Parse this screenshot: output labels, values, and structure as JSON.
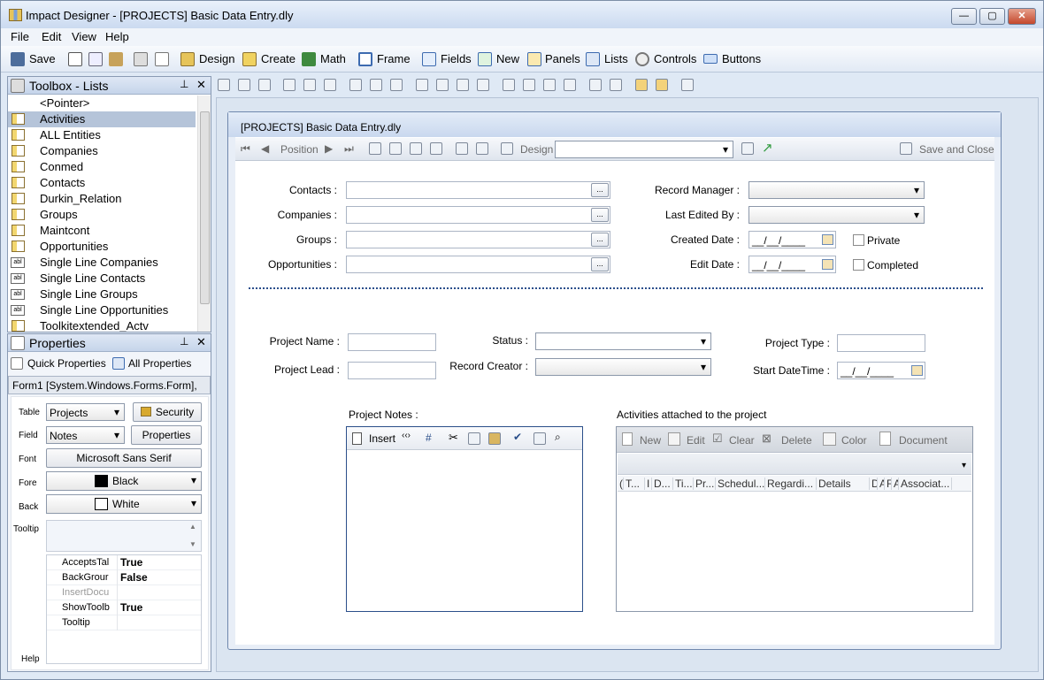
{
  "window": {
    "title": "Impact Designer - [PROJECTS] Basic Data Entry.dly"
  },
  "menu": [
    "File",
    "Edit",
    "View",
    "Help"
  ],
  "toolbar": {
    "save": "Save",
    "design": "Design",
    "create": "Create",
    "math": "Math",
    "frame": "Frame",
    "fields": "Fields",
    "new": "New",
    "panels": "Panels",
    "lists": "Lists",
    "controls": "Controls",
    "buttons": "Buttons"
  },
  "toolbox": {
    "title": "Toolbox - Lists",
    "items": [
      {
        "label": "<Pointer>",
        "icon": "none"
      },
      {
        "label": "Activities",
        "icon": "table"
      },
      {
        "label": "ALL Entities",
        "icon": "table"
      },
      {
        "label": "Companies",
        "icon": "table"
      },
      {
        "label": "Conmed",
        "icon": "table"
      },
      {
        "label": "Contacts",
        "icon": "table"
      },
      {
        "label": "Durkin_Relation",
        "icon": "table"
      },
      {
        "label": "Groups",
        "icon": "table"
      },
      {
        "label": "Maintcont",
        "icon": "table"
      },
      {
        "label": "Opportunities",
        "icon": "table"
      },
      {
        "label": "Single Line Companies",
        "icon": "abl"
      },
      {
        "label": "Single Line Contacts",
        "icon": "abl"
      },
      {
        "label": "Single Line Groups",
        "icon": "abl"
      },
      {
        "label": "Single Line Opportunities",
        "icon": "abl"
      },
      {
        "label": "Toolkitextended_Actv",
        "icon": "table"
      }
    ],
    "abl_text": "abl"
  },
  "properties": {
    "title": "Properties",
    "quick": "Quick Properties",
    "all": "All Properties",
    "object": "Form1 [System.Windows.Forms.Form],",
    "table_label": "Table",
    "table_value": "Projects",
    "security": "Security",
    "field_label": "Field",
    "field_value": "Notes",
    "properties_btn": "Properties",
    "font_label": "Font",
    "font_value": "Microsoft Sans Serif",
    "fore_label": "Fore",
    "fore_value": "Black",
    "back_label": "Back",
    "back_value": "White",
    "tooltip_label": "Tooltip",
    "help_label": "Help",
    "grid": [
      {
        "name": "AcceptsTal",
        "value": "True",
        "dim": false
      },
      {
        "name": "BackGrour",
        "value": "False",
        "dim": false
      },
      {
        "name": "InsertDocu",
        "value": "",
        "dim": true
      },
      {
        "name": "ShowToolb",
        "value": "True",
        "dim": false
      },
      {
        "name": "Tooltip",
        "value": "",
        "dim": false
      }
    ],
    "colors": {
      "black": "#000000",
      "white": "#ffffff"
    }
  },
  "form": {
    "title": "[PROJECTS] Basic Data Entry.dly",
    "nav_position": "Position",
    "nav_design": "Design",
    "save_close": "Save and Close",
    "contacts": "Contacts :",
    "companies": "Companies :",
    "groups": "Groups :",
    "opportunities": "Opportunities :",
    "record_manager": "Record Manager :",
    "last_edited_by": "Last Edited By :",
    "created_date": "Created Date :",
    "edit_date": "Edit Date :",
    "date_mask": "__/__/____",
    "private": "Private",
    "completed": "Completed",
    "project_name": "Project Name :",
    "project_lead": "Project Lead :",
    "status": "Status :",
    "record_creator": "Record Creator :",
    "project_type": "Project Type :",
    "start_datetime": "Start DateTime :",
    "project_notes": "Project Notes :",
    "insert": "Insert",
    "activities_caption": "Activities attached to the project",
    "act_new": "New",
    "act_edit": "Edit",
    "act_clear": "Clear",
    "act_delete": "Delete",
    "act_color": "Color",
    "act_document": "Document",
    "columns": [
      "(",
      "T...",
      "I",
      "D...",
      "Ti...",
      "Pr...",
      "Schedul...",
      "Regardi...",
      "Details",
      "D",
      "A",
      "F",
      "A",
      "Associat..."
    ]
  }
}
